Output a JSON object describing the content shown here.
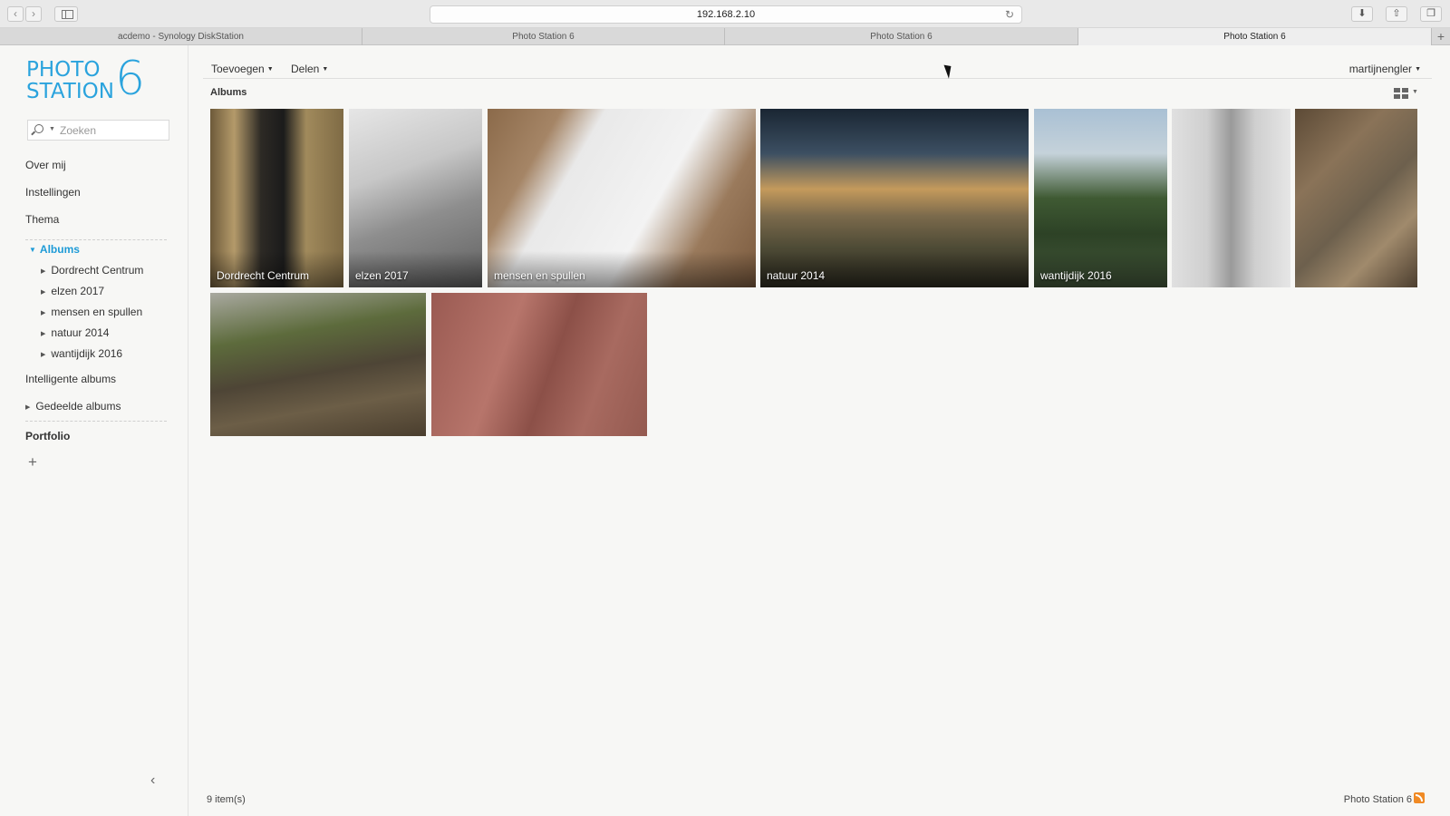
{
  "browser": {
    "address": "192.168.2.10",
    "tabs": [
      "acdemo - Synology DiskStation",
      "Photo Station 6",
      "Photo Station 6",
      "Photo Station 6"
    ]
  },
  "logo": {
    "line1": "PHOTO",
    "line2": "STATION",
    "number": "6"
  },
  "search": {
    "placeholder": "Zoeken"
  },
  "sidebar": {
    "items": [
      "Over mij",
      "Instellingen",
      "Thema"
    ],
    "albums_label": "Albums",
    "albums": [
      "Dordrecht Centrum",
      "elzen 2017",
      "mensen en spullen",
      "natuur 2014",
      "wantijdijk 2016"
    ],
    "smart_albums": "Intelligente albums",
    "shared_albums": "Gedeelde albums",
    "portfolio": "Portfolio",
    "add_symbol": "+",
    "collapse_symbol": "‹"
  },
  "toolbar": {
    "add": "Toevoegen",
    "share": "Delen",
    "user": "martijnengler"
  },
  "section_title": "Albums",
  "tiles": [
    {
      "caption": "Dordrecht Centrum"
    },
    {
      "caption": "elzen 2017"
    },
    {
      "caption": "mensen en spullen"
    },
    {
      "caption": "natuur 2014"
    },
    {
      "caption": "wantijdijk 2016"
    },
    {
      "caption": ""
    },
    {
      "caption": ""
    },
    {
      "caption": ""
    },
    {
      "caption": ""
    }
  ],
  "footer": {
    "count": "9 item(s)",
    "brand": "Photo Station 6"
  },
  "colors": {
    "accent": "#2aa3dd",
    "rss": "#f08a24"
  }
}
